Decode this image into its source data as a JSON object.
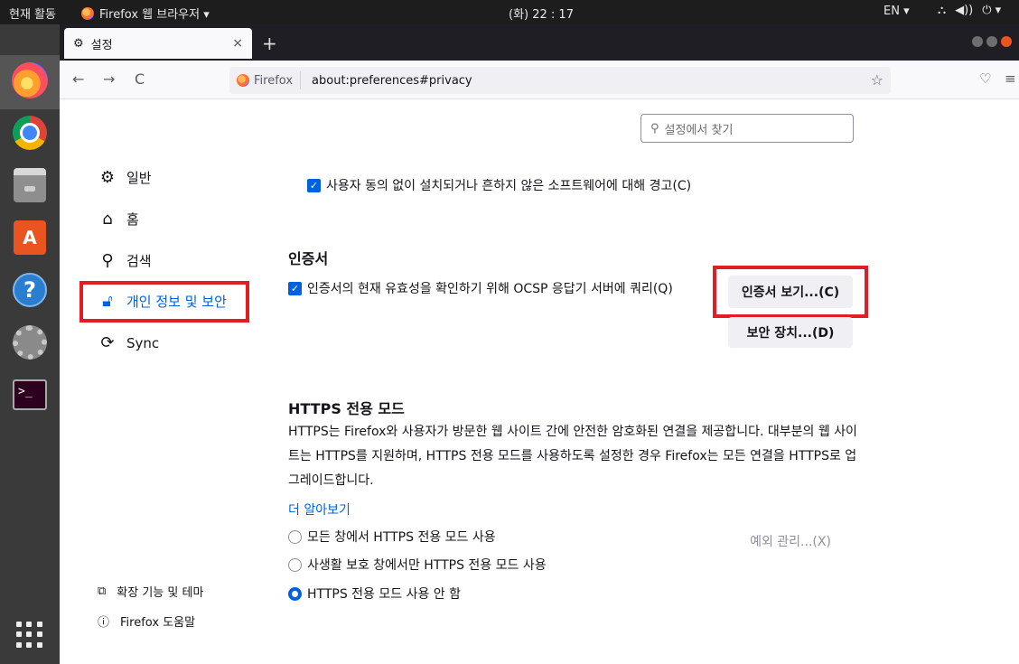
{
  "topbar": {
    "activities": "현재 활동",
    "app_menu": "Firefox 웹 브라우저 ▾",
    "clock": "(화) 22 : 17",
    "lang": "EN ▾",
    "sys_network": "⛬",
    "sys_volume": "◀))",
    "sys_power": "⏻ ▾"
  },
  "dock": {
    "items": [
      "firefox",
      "chrome",
      "files",
      "software-center",
      "help",
      "settings",
      "terminal"
    ],
    "terminal_prompt": ">_"
  },
  "browser": {
    "tab_title": "설정",
    "tab_close": "×",
    "new_tab": "+",
    "back": "←",
    "forward": "→",
    "reload": "C",
    "identity_label": "Firefox",
    "url": "about:preferences#privacy",
    "bookmark_star": "☆",
    "pocket": "♡",
    "menu": "≡"
  },
  "prefs": {
    "search_placeholder": "설정에서 찾기",
    "categories": [
      {
        "icon": "gear-icon",
        "label": "일반"
      },
      {
        "icon": "home-icon",
        "label": "홈"
      },
      {
        "icon": "search-icon",
        "label": "검색"
      },
      {
        "icon": "lock-icon",
        "label": "개인 정보 및 보안"
      },
      {
        "icon": "sync-icon",
        "label": "Sync"
      }
    ],
    "active_category": "개인 정보 및 보안",
    "footer": {
      "extensions": "확장 기능 및 테마",
      "help": "Firefox 도움말"
    },
    "warn_unwanted": "사용자 동의 없이 설치되거나 흔하지 않은 소프트웨어에 대해 경고(C)",
    "certificates": {
      "heading": "인증서",
      "ocsp_label": "인증서의 현재 유효성을 확인하기 위해 OCSP 응답기 서버에 쿼리(Q)",
      "view_button": "인증서 보기...(C)",
      "devices_button": "보안 장치...(D)"
    },
    "https_only": {
      "heading": "HTTPS 전용 모드",
      "description": "HTTPS는 Firefox와 사용자가 방문한 웹 사이트 간에 안전한 암호화된 연결을 제공합니다. 대부분의 웹 사이트는 HTTPS를 지원하며, HTTPS 전용 모드를 사용하도록 설정한 경우 Firefox는 모든 연결을 HTTPS로 업그레이드합니다.",
      "learn_more": "더 알아보기",
      "options": [
        "모든 창에서 HTTPS 전용 모드 사용",
        "사생활 보호 창에서만 HTTPS 전용 모드 사용",
        "HTTPS 전용 모드 사용 안 함"
      ],
      "selected": "HTTPS 전용 모드 사용 안 함",
      "exceptions_button": "예외 관리...(X)"
    }
  },
  "colors": {
    "accent": "#0061e0",
    "highlight_box": "#e11d25"
  }
}
